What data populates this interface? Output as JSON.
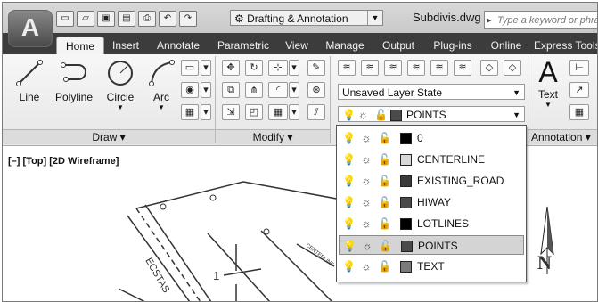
{
  "app": {
    "logo_letter": "A"
  },
  "quick_access": {
    "buttons": [
      {
        "icon": "new-icon",
        "glyph": "▭"
      },
      {
        "icon": "open-icon",
        "glyph": "📂"
      },
      {
        "icon": "save-icon",
        "glyph": "▣"
      },
      {
        "icon": "save-as-icon",
        "glyph": "▤"
      },
      {
        "icon": "print-icon",
        "glyph": "⎙"
      },
      {
        "icon": "undo-icon",
        "glyph": "↶"
      },
      {
        "icon": "redo-icon",
        "glyph": "↷"
      }
    ]
  },
  "workspace": {
    "label": "Drafting & Annotation"
  },
  "document": {
    "title": "Subdivis.dwg"
  },
  "search": {
    "placeholder": "Type a keyword or phrase"
  },
  "tabs": [
    "Home",
    "Insert",
    "Annotate",
    "Parametric",
    "View",
    "Manage",
    "Output",
    "Plug-ins",
    "Online",
    "Express Tools"
  ],
  "active_tab": "Home",
  "draw_panel": {
    "title": "Draw",
    "tools": [
      "Line",
      "Polyline",
      "Circle",
      "Arc"
    ]
  },
  "modify_panel": {
    "title": "Modify"
  },
  "layers_panel": {
    "layer_state": "Unsaved Layer State",
    "current_layer": "POINTS"
  },
  "annotation_panel": {
    "title": "Annotation",
    "text_tool": "Text"
  },
  "viewport": {
    "label": "[–] [Top] [2D Wireframe]",
    "compass_letter": "N",
    "lot_number": "1",
    "street_label": "ECSTAS",
    "curb_label": "CENTERLINE"
  },
  "layers": [
    {
      "name": "0",
      "color": "#000000"
    },
    {
      "name": "CENTERLINE",
      "color": "#d8d8d8"
    },
    {
      "name": "EXISTING_ROAD",
      "color": "#3a3a3a"
    },
    {
      "name": "HIWAY",
      "color": "#4a4a4a"
    },
    {
      "name": "LOTLINES",
      "color": "#000000"
    },
    {
      "name": "POINTS",
      "color": "#4a4a4a",
      "selected": true
    },
    {
      "name": "TEXT",
      "color": "#7a7a7a"
    }
  ]
}
